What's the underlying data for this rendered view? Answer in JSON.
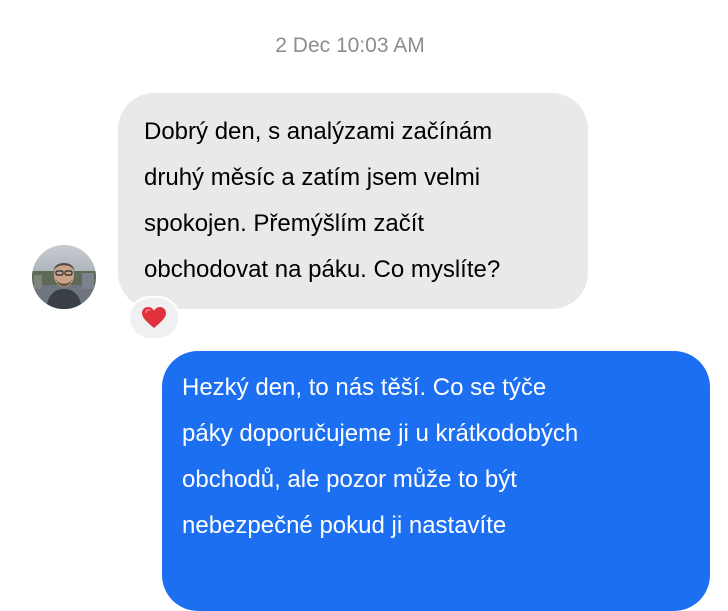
{
  "thread": {
    "timestamp": "2 Dec 10:03 AM",
    "messages": [
      {
        "direction": "incoming",
        "text": "Dobrý den, s analýzami začínám\ndruhý měsíc a zatím jsem velmi\nspokojen. Přemýšlím začít\nobchodovat na páku. Co myslíte?",
        "reaction_icon": "heart-icon"
      },
      {
        "direction": "outgoing",
        "text": "Hezký den, to nás těší. Co se týče\npáky doporučujeme ji u krátkodobých\nobchodů, ale pozor může to být\nnebezpečné pokud ji nastavíte"
      }
    ]
  },
  "colors": {
    "incoming_bubble": "#e9e9eb",
    "outgoing_bubble": "#1d6ff2",
    "timestamp": "#8a8d91",
    "reaction": "#e0323c"
  }
}
